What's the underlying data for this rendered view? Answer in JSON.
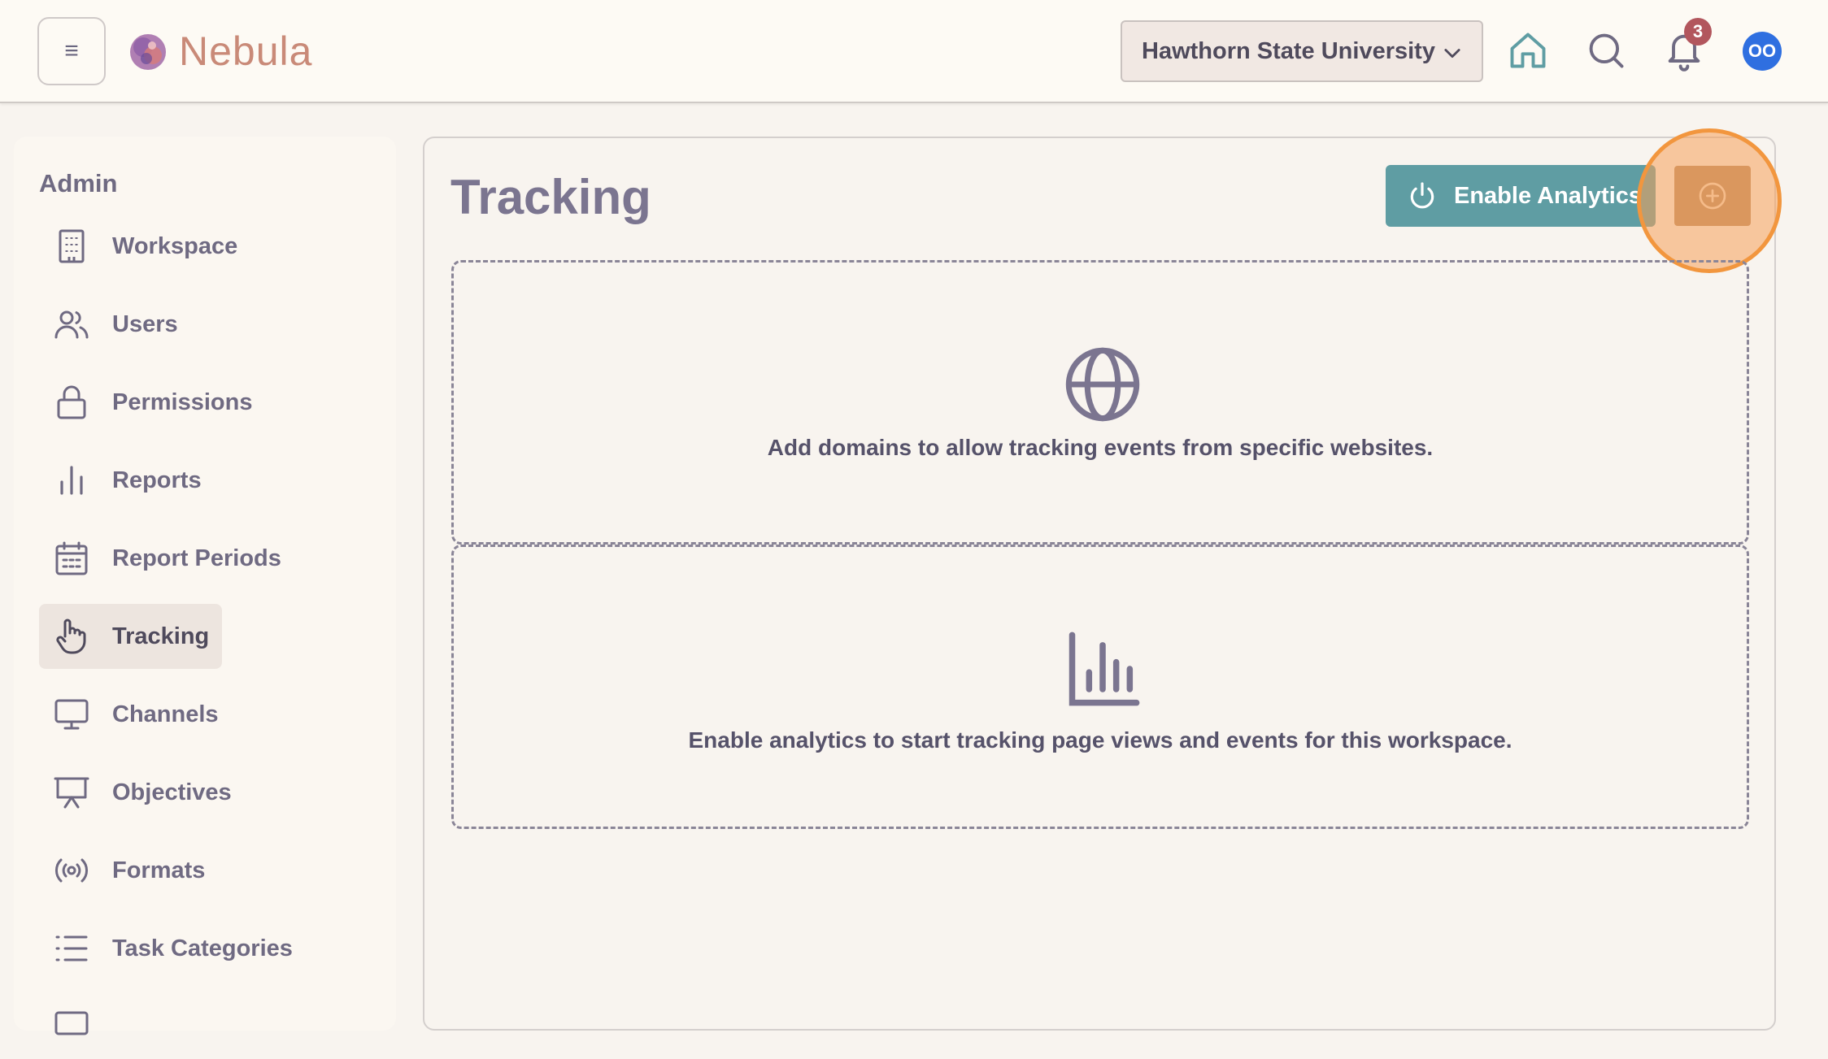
{
  "header": {
    "app_name": "Nebula",
    "organization": "Hawthorn State University",
    "notification_count": "3",
    "avatar_initials": "OO"
  },
  "sidebar": {
    "heading": "Admin",
    "items": [
      {
        "label": "Workspace",
        "icon": "building-icon"
      },
      {
        "label": "Users",
        "icon": "users-icon"
      },
      {
        "label": "Permissions",
        "icon": "lock-icon"
      },
      {
        "label": "Reports",
        "icon": "bar-chart-icon"
      },
      {
        "label": "Report Periods",
        "icon": "calendar-icon"
      },
      {
        "label": "Tracking",
        "icon": "hand-pointer-icon",
        "active": true
      },
      {
        "label": "Channels",
        "icon": "monitor-icon"
      },
      {
        "label": "Objectives",
        "icon": "presentation-icon"
      },
      {
        "label": "Formats",
        "icon": "broadcast-icon"
      },
      {
        "label": "Task Categories",
        "icon": "list-icon"
      }
    ]
  },
  "main": {
    "title": "Tracking",
    "enable_analytics_label": "Enable Analytics",
    "domains_empty_text": "Add domains to allow tracking events from specific websites.",
    "analytics_empty_text": "Enable analytics to start tracking page views and events for this workspace."
  },
  "colors": {
    "accent_teal": "#5f9da3",
    "add_button_brown": "#b98c64",
    "highlight_orange": "#f2963e",
    "badge_red": "#b2565d",
    "avatar_blue": "#2f6fe0"
  }
}
